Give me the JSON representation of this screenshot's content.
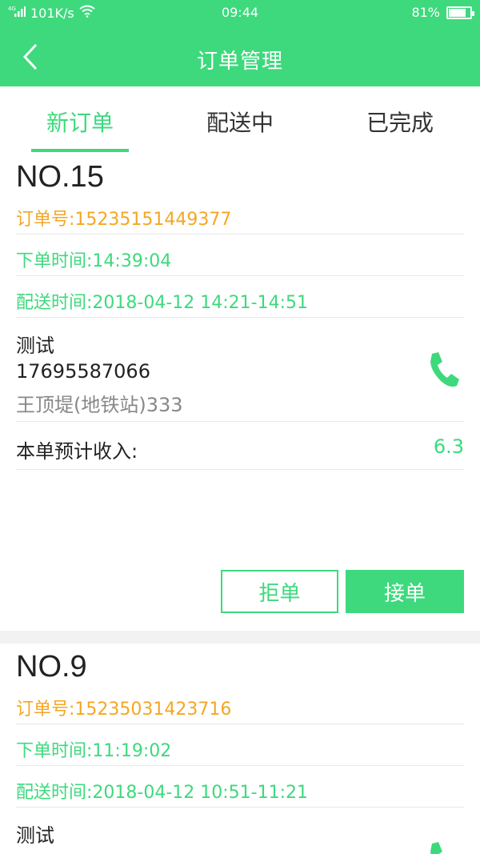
{
  "status_bar": {
    "network": "⁴G",
    "speed": "101K/s",
    "time": "09:44",
    "battery": "81%",
    "battery_level": 0.81
  },
  "header": {
    "title": "订单管理",
    "back_icon": "chevron-left-icon"
  },
  "tabs": [
    {
      "label": "新订单",
      "active": true
    },
    {
      "label": "配送中",
      "active": false
    },
    {
      "label": "已完成",
      "active": false
    }
  ],
  "orders": [
    {
      "no": "NO.15",
      "order_id": "订单号:15235151449377",
      "order_time": "下单时间:14:39:04",
      "delivery_time": "配送时间:2018-04-12 14:21-14:51",
      "customer_name": "测试",
      "customer_phone": "17695587066",
      "address": "王顶堤(地铁站)333",
      "income_label": "本单预计收入:",
      "income_value": "6.3",
      "reject_label": "拒单",
      "accept_label": "接单"
    },
    {
      "no": "NO.9",
      "order_id": "订单号:15235031423716",
      "order_time": "下单时间:11:19:02",
      "delivery_time": "配送时间:2018-04-12 10:51-11:21",
      "customer_name": "测试"
    }
  ],
  "colors": {
    "primary": "#3ed97d",
    "orange": "#f5a623",
    "gray_text": "#888888"
  }
}
